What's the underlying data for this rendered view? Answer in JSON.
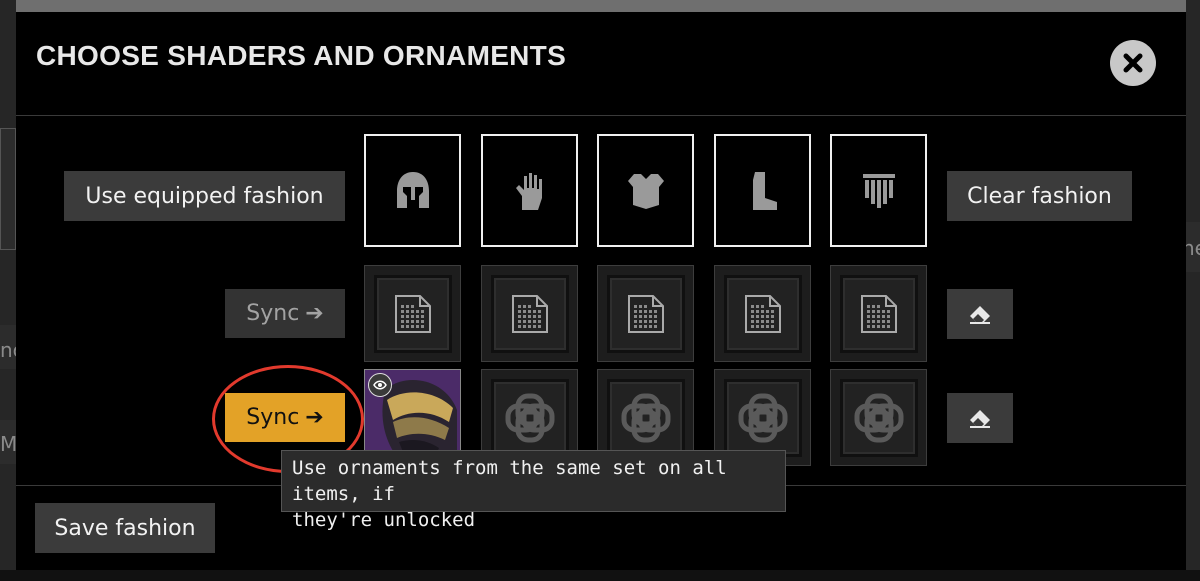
{
  "background": {
    "fragments": [
      "he",
      "nc",
      "Mc"
    ]
  },
  "modal": {
    "title": "CHOOSE SHADERS AND ORNAMENTS",
    "close_icon": "close-icon",
    "use_equipped_label": "Use equipped fashion",
    "clear_fashion_label": "Clear fashion",
    "save_fashion_label": "Save fashion",
    "armor_slots": [
      {
        "name": "helmet",
        "icon": "helmet-icon"
      },
      {
        "name": "gauntlets",
        "icon": "gauntlet-icon"
      },
      {
        "name": "chest",
        "icon": "chest-armor-icon"
      },
      {
        "name": "legs",
        "icon": "boot-icon"
      },
      {
        "name": "class-item",
        "icon": "class-item-icon"
      }
    ],
    "shader_row": {
      "sync_label": "Sync",
      "sync_icon": "arrow-right-icon",
      "clear_icon": "eraser-icon"
    },
    "ornament_row": {
      "sync_label": "Sync",
      "sync_icon": "arrow-right-icon",
      "clear_icon": "eraser-icon",
      "sync_color": "#e3a227"
    },
    "tooltip": "Use ornaments from the same set on all items, if\nthey're unlocked"
  },
  "colors": {
    "accent": "#e3a227",
    "highlight_ring": "#e23a2d"
  }
}
